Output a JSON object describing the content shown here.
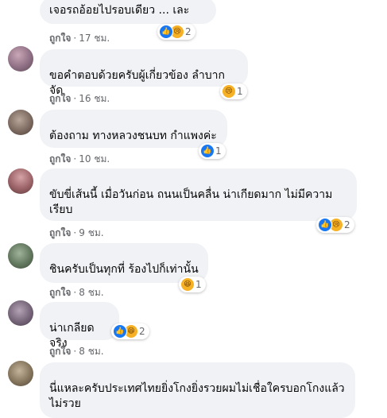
{
  "comments": [
    {
      "author": "",
      "text": "เจอรถอ้อยไปรอบเดียว ... เละ",
      "like": "ถูกใจ",
      "time": "17 ชม.",
      "reactions": [
        "like-icon",
        "sad-icon"
      ],
      "reaction_count": "2"
    },
    {
      "author": "",
      "text": "ขอคำตอบด้วยครับผู้เกี่ยวข้อง ลำบากจัด",
      "like": "ถูกใจ",
      "time": "16 ชม.",
      "reactions": [
        "sad-icon"
      ],
      "reaction_count": "1"
    },
    {
      "author": "",
      "text": "ต้องถาม ทางหลวงชนบท กำแพงค่ะ",
      "like": "ถูกใจ",
      "time": "10 ชม.",
      "reactions": [
        "like-icon"
      ],
      "reaction_count": "1"
    },
    {
      "author": "",
      "text_line1": "ขับขี่เส้นนี้ เมื่อวันก่อน ถนนเป็นคลื่น น่าเกียดมาก ไม่มีความ",
      "text_line2": "เรียบ",
      "like": "ถูกใจ",
      "time": "9 ชม.",
      "reactions": [
        "like-icon",
        "sad-icon"
      ],
      "reaction_count": "2"
    },
    {
      "author": "",
      "text": "ชินครับเป็นทุกที่ ร้องไปก็เท่านั้น",
      "like": "ถูกใจ",
      "time": "8 ชม.",
      "reactions": [
        "haha-icon"
      ],
      "reaction_count": "1"
    },
    {
      "author": "",
      "text": "น่าเกลียดจริง",
      "like": "ถูกใจ",
      "time": "8 ชม.",
      "reactions": [
        "like-icon",
        "haha-icon"
      ],
      "reaction_count": "2"
    },
    {
      "author": "",
      "text_line1": "นี่แหละครับประเทศไทยยิ่งโกงยิ่งรวยผมไม่เชื่อใครบอกโกงแล้ว",
      "text_line2": "ไม่รวย"
    }
  ],
  "separator": "·",
  "colors": {
    "bubble": "#f0f2f5",
    "meta": "#65676b",
    "like_blue": "#1877f2",
    "emoji_yellow": "#f7b125"
  }
}
